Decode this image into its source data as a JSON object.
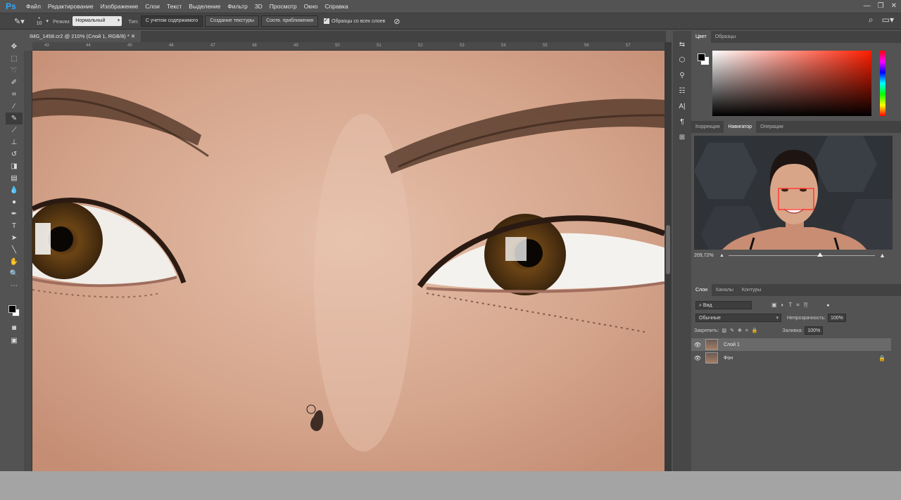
{
  "menubar": {
    "logo": "Ps",
    "items": [
      "Файл",
      "Редактирование",
      "Изображение",
      "Слои",
      "Текст",
      "Выделение",
      "Фильтр",
      "3D",
      "Просмотр",
      "Окно",
      "Справка"
    ],
    "controls": [
      "—",
      "❐",
      "✕"
    ]
  },
  "options": {
    "brush_size": "10",
    "mode_label": "Режим:",
    "mode_value": "Нормальный",
    "type_label": "Тип:",
    "type_buttons": [
      "С учетом содержимого",
      "Создание текстуры",
      "Соотв. приближения"
    ],
    "sample_all": "Образцы со всех слоев"
  },
  "document": {
    "tab_title": "IMG_1458.cr2 @ 210% (Слой 1, RGB/8) *",
    "ruler_ticks": [
      "43",
      "44",
      "45",
      "46",
      "47",
      "48",
      "49",
      "50",
      "51",
      "52",
      "53",
      "54",
      "55",
      "56",
      "57"
    ]
  },
  "panels": {
    "color_tabs": [
      "Цвет",
      "Образцы"
    ],
    "nav_tabs": [
      "Коррекция",
      "Навигатор",
      "Операции"
    ],
    "zoom": "209,72%",
    "layers_tabs": [
      "Слои",
      "Каналы",
      "Контуры"
    ],
    "filter": "Вид",
    "blend_mode": "Обычные",
    "opacity_label": "Непрозрачность:",
    "opacity_value": "100%",
    "lock_label": "Закрепить:",
    "fill_label": "Заливка:",
    "fill_value": "100%",
    "layers": [
      {
        "name": "Слой 1",
        "selected": true
      },
      {
        "name": "Фон",
        "locked": true
      }
    ]
  },
  "colors": {
    "accent": "#31a8ff",
    "foreground": "#000000",
    "background": "#ffffff"
  }
}
